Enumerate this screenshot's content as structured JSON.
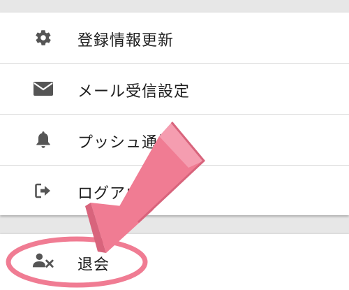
{
  "menu": {
    "items": [
      {
        "label": "登録情報更新",
        "icon": "gear-icon"
      },
      {
        "label": "メール受信設定",
        "icon": "envelope-icon"
      },
      {
        "label": "プッシュ通知",
        "icon": "bell-icon"
      },
      {
        "label": "ログアウト",
        "icon": "sign-out-icon"
      }
    ]
  },
  "withdraw": {
    "label": "退会",
    "icon": "user-remove-icon"
  },
  "annotation": {
    "arrow_color": "#f07c93",
    "circle_color": "#f07c93"
  },
  "colors": {
    "icon": "#555555",
    "text": "#1f1f1f",
    "background": "#e7e7e7",
    "card": "#ffffff"
  }
}
